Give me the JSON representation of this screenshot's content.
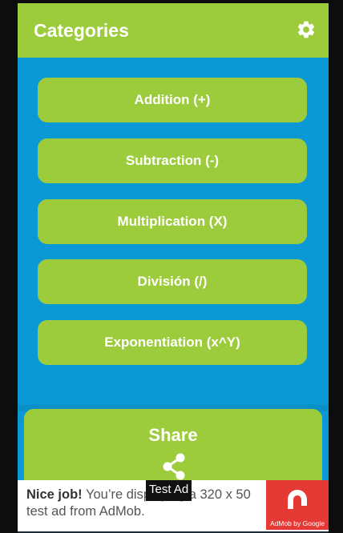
{
  "header": {
    "title": "Categories",
    "settings_icon": "gear-icon"
  },
  "categories": [
    {
      "label": "Addition (+)"
    },
    {
      "label": "Subtraction (-)"
    },
    {
      "label": "Multiplication (X)"
    },
    {
      "label": "División (/)"
    },
    {
      "label": "Exponentiation (x^Y)"
    }
  ],
  "share": {
    "label": "Share",
    "icon": "share-icon"
  },
  "ad": {
    "headline": "Nice job!",
    "body": " You’re displaying a 320 x 50 test ad from AdMob.",
    "overlay": "Test Ad",
    "badge_label": "AdMob by Google"
  },
  "colors": {
    "primary_green": "#9ccc3c",
    "background_blue": "#0a99d4",
    "ad_red": "#e53935"
  }
}
